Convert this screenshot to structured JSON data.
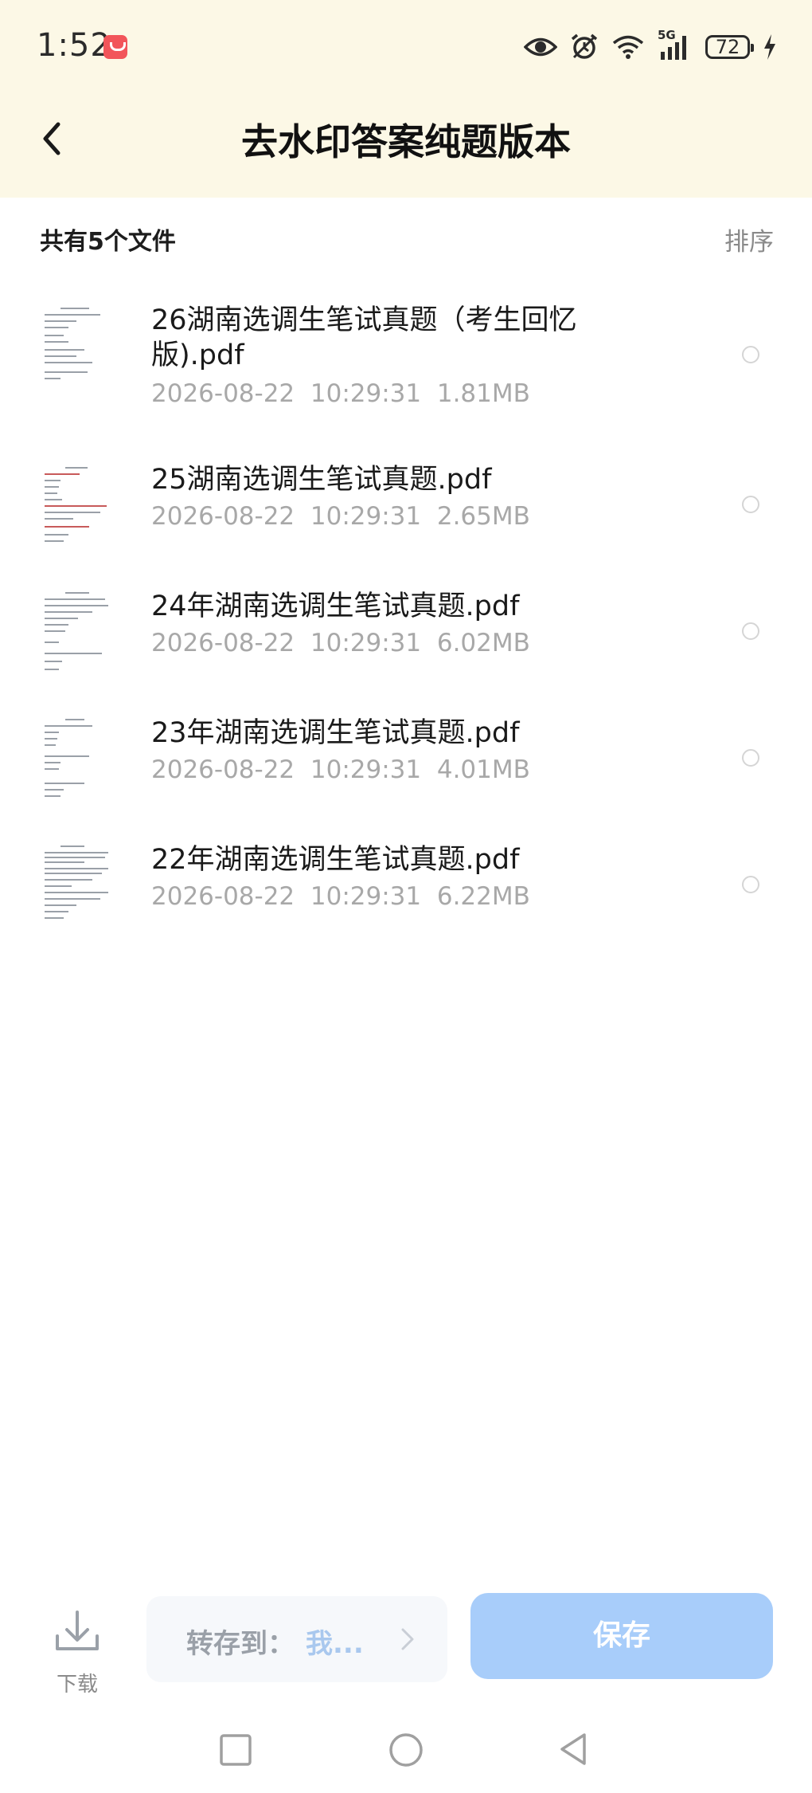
{
  "status_bar": {
    "time": "1:52",
    "network": "5G",
    "battery": "72",
    "icons": [
      "notification-app-icon",
      "eye-icon",
      "alarm-icon",
      "wifi-icon",
      "signal-icon",
      "battery-icon",
      "charging-icon"
    ]
  },
  "header": {
    "title": "去水印答案纯题版本",
    "back_icon": "chevron-left-icon"
  },
  "list_header": {
    "count_label": "共有5个文件",
    "sort_label": "排序"
  },
  "files": [
    {
      "name": "26湖南选调生笔试真题（考生回忆版).pdf",
      "date": "2026-08-22",
      "time": "10:29:31",
      "size": "1.81MB"
    },
    {
      "name": "25湖南选调生笔试真题.pdf",
      "date": "2026-08-22",
      "time": "10:29:31",
      "size": "2.65MB"
    },
    {
      "name": "24年湖南选调生笔试真题.pdf",
      "date": "2026-08-22",
      "time": "10:29:31",
      "size": "6.02MB"
    },
    {
      "name": "23年湖南选调生笔试真题.pdf",
      "date": "2026-08-22",
      "time": "10:29:31",
      "size": "4.01MB"
    },
    {
      "name": "22年湖南选调生笔试真题.pdf",
      "date": "2026-08-22",
      "time": "10:29:31",
      "size": "6.22MB"
    }
  ],
  "bottom_bar": {
    "download_label": "下载",
    "transfer_label": "转存到：",
    "transfer_value": "我...",
    "save_label": "保存"
  },
  "colors": {
    "header_bg": "#fcf8e6",
    "save_button": "#a8cdfa",
    "transfer_value": "#a9c8ee",
    "meta_text": "#a8a8a8"
  },
  "nav_bar": {
    "icons": [
      "square-recents-icon",
      "circle-home-icon",
      "triangle-back-icon"
    ]
  }
}
